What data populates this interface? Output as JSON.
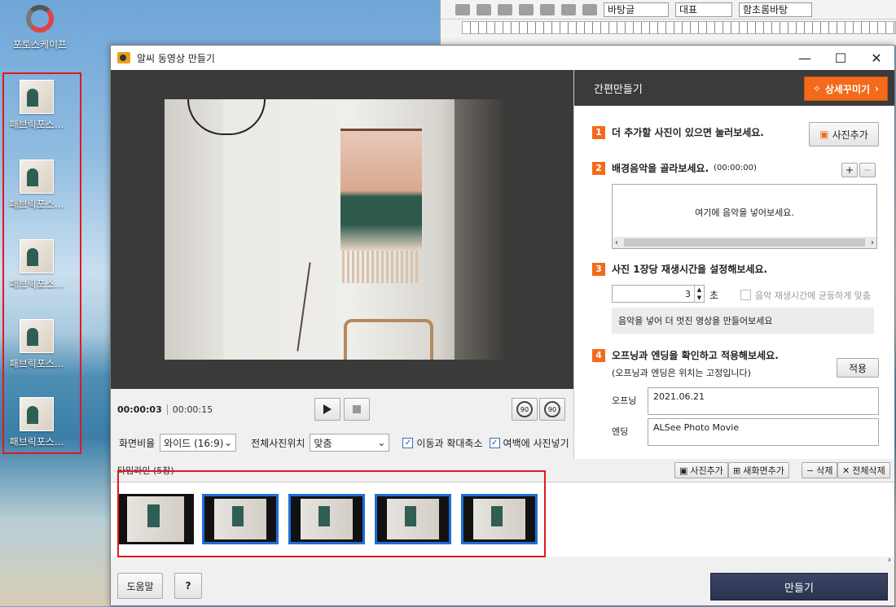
{
  "desktop": {
    "app_icon_label": "포토스케이프",
    "icons": [
      {
        "label": "패브릭포스..."
      },
      {
        "label": "패브릭포스..."
      },
      {
        "label": "패브릭포스..."
      },
      {
        "label": "패브릭포스..."
      },
      {
        "label": "패브릭포스..."
      }
    ]
  },
  "hwp": {
    "font_style": "바탕글",
    "font_rep": "대표",
    "font_name": "함초롬바탕"
  },
  "window": {
    "title": "알씨 동영상 만들기",
    "minimize": "—",
    "maximize": "☐",
    "close": "✕"
  },
  "player": {
    "current_time": "00:00:03",
    "total_time": "00:00:15",
    "play_icon": "play-icon",
    "stop_icon": "stop-icon",
    "rotate_left_label": "90",
    "rotate_right_label": "90"
  },
  "options": {
    "ratio_label": "화면비율",
    "ratio_value": "와이드 (16:9)",
    "position_label": "전체사진위치",
    "position_value": "맞춤",
    "zoom_label": "이동과 확대축소",
    "zoom_checked": true,
    "margin_label": "여백에 사진넣기",
    "margin_checked": true
  },
  "panel": {
    "header": "간편만들기",
    "detail_button": "상세꾸미기",
    "step1": {
      "num": "1",
      "text": "더 추가할 사진이 있으면 눌러보세요.",
      "button": "사진추가"
    },
    "step2": {
      "num": "2",
      "text": "배경음악을 골라보세요.",
      "duration": "(00:00:00)",
      "add": "+",
      "remove": "−",
      "placeholder": "여기에 음악을 넣어보세요."
    },
    "step3": {
      "num": "3",
      "text": "사진 1장당 재생시간을 설정해보세요.",
      "seconds": "3",
      "unit": "초",
      "equal_label": "음악 재생시간에 균등하게 맞춤",
      "info": "음악을 넣어 더 멋진 영상을 만들어보세요"
    },
    "step4": {
      "num": "4",
      "text": "오프닝과 엔딩을 확인하고 적용해보세요.",
      "note": "(오프닝과 엔딩은 위치는 고정입니다)",
      "apply": "적용",
      "opening_label": "오프닝",
      "opening_value": "2021.06.21",
      "ending_label": "엔딩",
      "ending_value": "ALSee Photo Movie"
    }
  },
  "timeline": {
    "title": "타임라인 (5장)",
    "add_photo": "사진추가",
    "add_screen": "새화면추가",
    "delete": "삭제",
    "delete_all": "전체삭제",
    "frames": [
      {
        "selected": false
      },
      {
        "selected": true
      },
      {
        "selected": true
      },
      {
        "selected": true
      },
      {
        "selected": true
      }
    ]
  },
  "footer": {
    "help": "도움말",
    "question": "?",
    "make": "만들기"
  },
  "colors": {
    "accent": "#f36a1a",
    "selection": "#1f6ed8",
    "highlight_box": "#e0191d",
    "make_button": "#2a3250"
  }
}
